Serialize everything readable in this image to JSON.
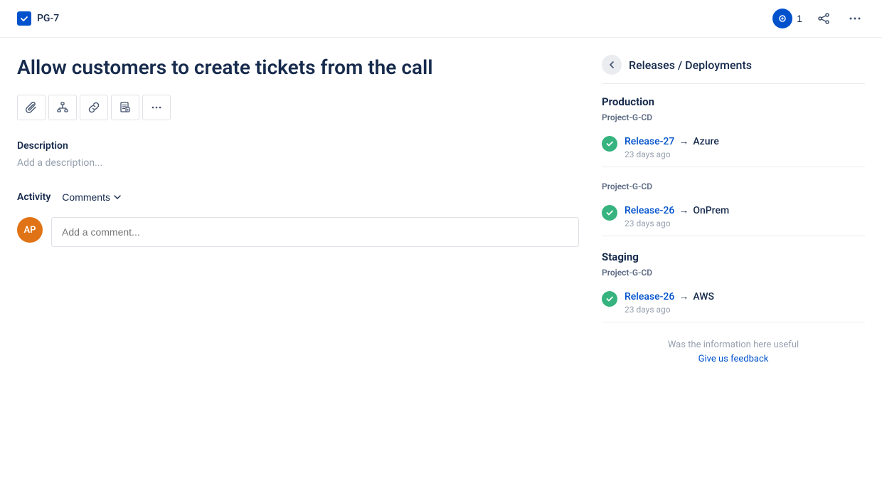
{
  "header": {
    "issue_id": "PG-7",
    "watch_count": "1",
    "back_label": "←"
  },
  "issue": {
    "title": "Allow customers to create tickets from the call"
  },
  "description": {
    "label": "Description",
    "placeholder": "Add a description..."
  },
  "activity": {
    "label": "Activity",
    "comments_label": "Comments",
    "comment_placeholder": "Add a comment...",
    "avatar_initials": "AP"
  },
  "releases": {
    "breadcrumb": "Releases / Deployments",
    "environments": [
      {
        "name": "Production",
        "project": "Project-G-CD",
        "releases": [
          {
            "release": "Release-27",
            "arrow": "→",
            "target": "Azure",
            "time": "23 days ago"
          }
        ]
      },
      {
        "name": "",
        "project": "Project-G-CD",
        "releases": [
          {
            "release": "Release-26",
            "arrow": "→",
            "target": "OnPrem",
            "time": "23 days ago"
          }
        ]
      },
      {
        "name": "Staging",
        "project": "Project-G-CD",
        "releases": [
          {
            "release": "Release-26",
            "arrow": "→",
            "target": "AWS",
            "time": "23 days ago"
          }
        ]
      }
    ],
    "feedback_text": "Was the information here useful",
    "feedback_link": "Give us feedback"
  },
  "toolbar": {
    "attach": "📎",
    "hierarchy": "⛙",
    "link": "🔗",
    "doc": "📋",
    "more": "···"
  }
}
